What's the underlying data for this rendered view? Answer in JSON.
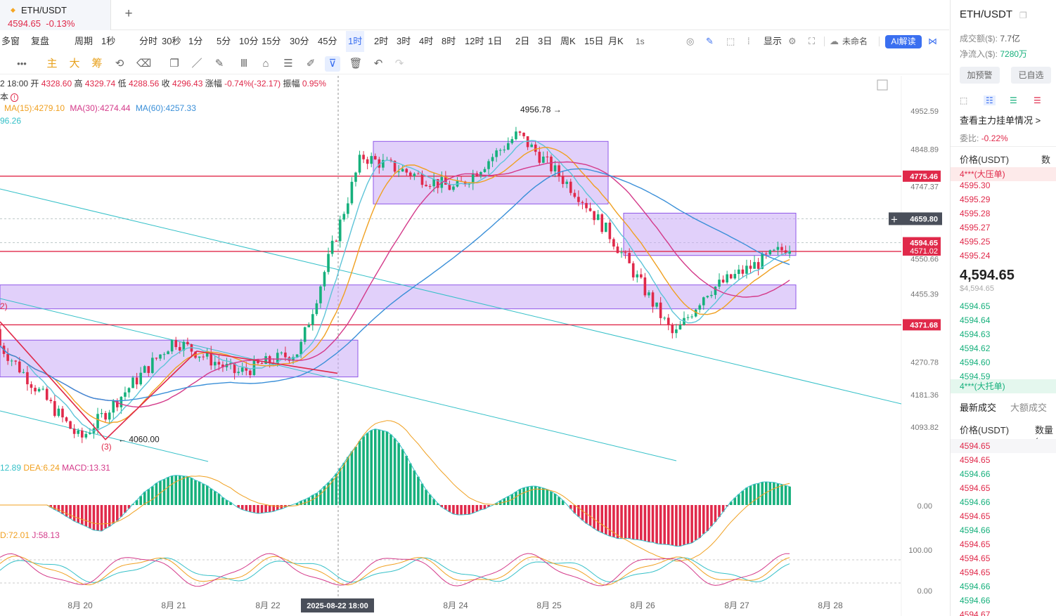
{
  "tab": {
    "symbol": "ETH/USDT",
    "price": "4594.65",
    "change": "-0.13%"
  },
  "toolbar": {
    "items": [
      "多窗",
      "复盘",
      "周期",
      "1秒",
      "分时",
      "30秒",
      "1分",
      "5分",
      "10分",
      "15分",
      "30分",
      "45分",
      "1时",
      "2时",
      "3时",
      "4时",
      "8时",
      "12时",
      "1日",
      "2日",
      "3日",
      "周K",
      "15日",
      "月K",
      "1s",
      "显示",
      "未命名",
      "AI解读"
    ],
    "active": "1时"
  },
  "toolbar2": {
    "labels": [
      "主",
      "大",
      "筹"
    ]
  },
  "ohlc": {
    "time": "2 18:00",
    "open_label": "开",
    "open": "4328.60",
    "high_label": "高",
    "high": "4329.74",
    "low_label": "低",
    "low": "4288.56",
    "close_label": "收",
    "close": "4296.43",
    "change_label": "涨幅",
    "change": "-0.74%(-32.17)",
    "amp_label": "振幅",
    "amp": "0.95%",
    "cost_label": "本"
  },
  "ma_line": {
    "ma15": "MA(15):4279.10",
    "ma30": "MA(30):4274.44",
    "ma60": "MA(60):4257.33",
    "extra": "96.26"
  },
  "macd_line": {
    "dif": "12.89",
    "dea": "DEA:6.24",
    "macd": "MACD:13.31"
  },
  "kdj_line": {
    "d": "D:72.01",
    "j": "J:58.13"
  },
  "chart_data": {
    "type": "candlestick",
    "symbol": "ETH/USDT",
    "interval": "1时",
    "price_axis_ticks": [
      4952.59,
      4848.89,
      4747.37,
      4659.8,
      4550.66,
      4455.39,
      4371.68,
      4270.78,
      4181.36,
      4093.82
    ],
    "price_axis_tick_labels": [
      "4952.59",
      "4848.89",
      "4747.37",
      "4550.66",
      "4455.39",
      "4270.78",
      "4181.36",
      "4093.82"
    ],
    "y_range": [
      4020,
      4990
    ],
    "x_labels": [
      "8月 20",
      "8月 21",
      "8月 22",
      "8月 24",
      "8月 25",
      "8月 26",
      "8月 27",
      "8月 28"
    ],
    "crosshair_time": "2025-08-22 18:00",
    "crosshair_price": "4659.80",
    "current_price": "4594.65",
    "current_price_value": 4594.65,
    "hidden_price_label": "4571.02",
    "horizontal_levels": [
      {
        "value": 4775.46,
        "label": "4775.46"
      },
      {
        "value": 4571.02,
        "label": "4571.02"
      },
      {
        "value": 4371.68,
        "label": "4371.68"
      }
    ],
    "annotations": [
      {
        "text": "4956.78",
        "price": 4956.78,
        "kind": "high"
      },
      {
        "text": "4060.00",
        "price": 4060.0,
        "kind": "low"
      },
      {
        "text": "(3)",
        "kind": "wave"
      },
      {
        "text": "2)",
        "kind": "wave"
      }
    ],
    "boxes": [
      {
        "from_price": 4330,
        "to_price": 4230
      },
      {
        "from_price": 4480,
        "to_price": 4415
      },
      {
        "from_price": 4870,
        "to_price": 4700
      },
      {
        "from_price": 4675,
        "to_price": 4560
      }
    ],
    "key_closes": [
      {
        "time": "8月 19",
        "price": 4360
      },
      {
        "time": "8月 20",
        "price": 4060
      },
      {
        "time": "8月 21",
        "price": 4330
      },
      {
        "time": "8月 22",
        "price": 4240
      },
      {
        "time": "8月 22",
        "price": 4300
      },
      {
        "time": "8月 23",
        "price": 4830
      },
      {
        "time": "8月 24",
        "price": 4740
      },
      {
        "time": "8月 25",
        "price": 4890
      },
      {
        "time": "8月 25",
        "price": 4720
      },
      {
        "time": "8月 26",
        "price": 4610
      },
      {
        "time": "8月 26",
        "price": 4340
      },
      {
        "time": "8月 27",
        "price": 4460
      },
      {
        "time": "8月 27",
        "price": 4590
      }
    ],
    "macd": {
      "zero_label": "0.00"
    },
    "kdj": {
      "axis_labels": [
        "100.00",
        "0.00"
      ]
    }
  },
  "panel": {
    "title": "ETH/USDT",
    "volume_label": "成交额($):",
    "volume": "7.7亿",
    "netflow_label": "净流入($):",
    "netflow": "7280万",
    "btn_alert": "加预警",
    "btn_fav": "已自选",
    "orders_link": "查看主力挂单情况 >",
    "ratio_label": "委比:",
    "ratio": "-0.22%",
    "col_price": "价格(USDT)",
    "col_qty": "数量",
    "big_ask": "4***(大压单)",
    "asks": [
      "4595.30",
      "4595.29",
      "4595.28",
      "4595.27",
      "4595.25",
      "4595.24"
    ],
    "last_price": "4,594.65",
    "last_usd": "$4,594.65",
    "bids": [
      "4594.65",
      "4594.64",
      "4594.63",
      "4594.62",
      "4594.60",
      "4594.59"
    ],
    "big_bid": "4***(大托单)",
    "tab_latest": "最新成交",
    "tab_large": "大额成交",
    "col_price2": "价格(USDT)",
    "col_qty2": "数量(",
    "trades": [
      {
        "p": "4594.65",
        "side": "ask"
      },
      {
        "p": "4594.65",
        "side": "ask"
      },
      {
        "p": "4594.66",
        "side": "bid"
      },
      {
        "p": "4594.65",
        "side": "ask"
      },
      {
        "p": "4594.66",
        "side": "bid"
      },
      {
        "p": "4594.65",
        "side": "ask"
      },
      {
        "p": "4594.66",
        "side": "bid"
      },
      {
        "p": "4594.65",
        "side": "ask"
      },
      {
        "p": "4594.65",
        "side": "ask"
      },
      {
        "p": "4594.65",
        "side": "ask"
      },
      {
        "p": "4594.66",
        "side": "bid"
      },
      {
        "p": "4594.66",
        "side": "bid"
      },
      {
        "p": "4594.67",
        "side": "ask"
      }
    ]
  },
  "colors": {
    "up": "#16b07c",
    "down": "#e0294a",
    "box": "#c9a9f5",
    "box_edge": "#8f57e8",
    "level": "#e0294a",
    "trend": "#35c0c8",
    "ma15": "#f0a020",
    "ma30": "#d43a8a",
    "ma60": "#3a8fd8",
    "accent": "#3a6ff0"
  }
}
